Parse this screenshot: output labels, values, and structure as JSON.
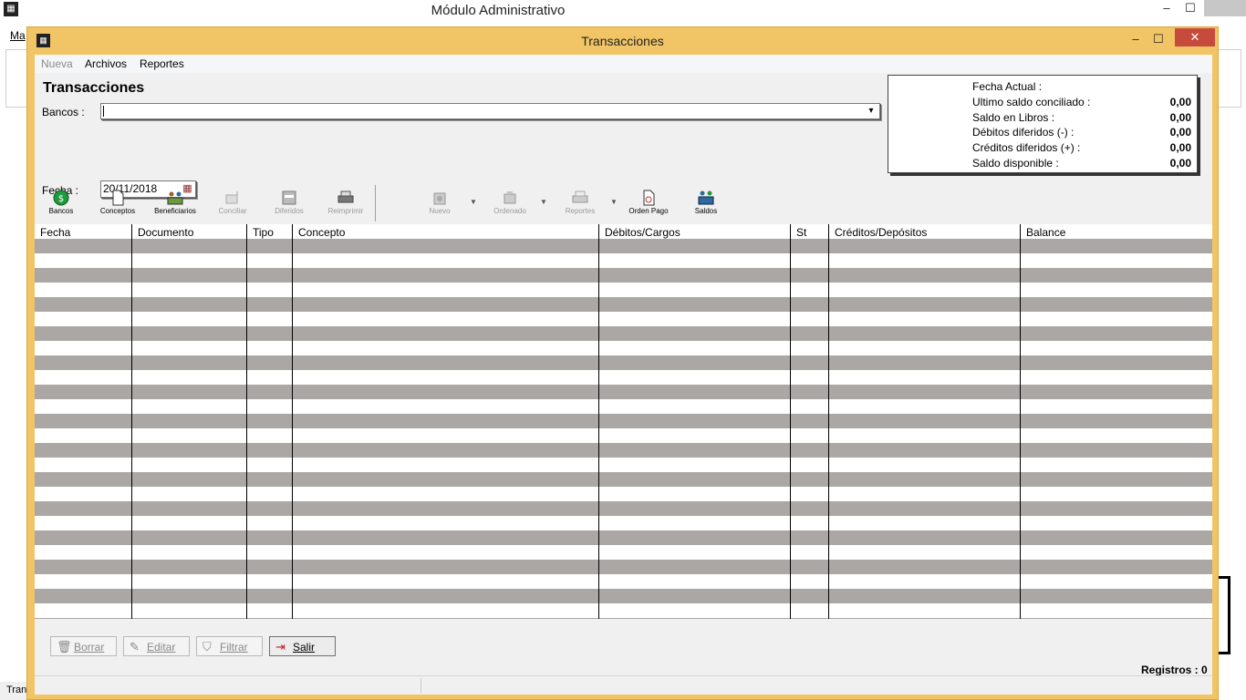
{
  "app": {
    "title": "Módulo Administrativo",
    "menu_fragment": "Ma",
    "status_fragment": "Tran",
    "minimize": "–",
    "maximize": "☐",
    "close": "✕"
  },
  "window": {
    "title": "Transacciones",
    "minimize": "–",
    "maximize": "☐",
    "close": "✕"
  },
  "menu": {
    "nueva": "Nueva",
    "archivos": "Archivos",
    "reportes": "Reportes"
  },
  "form": {
    "heading": "Transacciones",
    "bancos_label": "Bancos  :",
    "bancos_value": "",
    "fecha_label": "Fecha :",
    "fecha_value": "20/11/2018"
  },
  "summary": {
    "fecha_actual_label": "Fecha Actual :",
    "fecha_actual_value": "",
    "ultimo_saldo_label": "Ultimo saldo conciliado :",
    "ultimo_saldo_value": "0,00",
    "saldo_libros_label": "Saldo en Libros :",
    "saldo_libros_value": "0,00",
    "debitos_label": "Débitos diferidos (-) :",
    "debitos_value": "0,00",
    "creditos_label": "Créditos diferidos (+) :",
    "creditos_value": "0,00",
    "saldo_disp_label": "Saldo disponible :",
    "saldo_disp_value": "0,00"
  },
  "toolbar": {
    "bancos": "Bancos",
    "conceptos": "Conceptos",
    "beneficiarios": "Beneficiarios",
    "conciliar": "Conciliar",
    "diferidos": "Diferidos",
    "reimprimir": "Reimprimir",
    "nuevo": "Nuevo",
    "ordenado": "Ordenado",
    "reportes": "Reportes",
    "orden_pago": "Orden Pago",
    "saldos": "Saldos"
  },
  "grid": {
    "columns": [
      "Fecha",
      "Documento",
      "Tipo",
      "Concepto",
      "Débitos/Cargos",
      "St",
      "Créditos/Depósitos",
      "Balance"
    ]
  },
  "buttons": {
    "borrar": "Borrar",
    "editar": "Editar",
    "filtrar": "Filtrar",
    "salir": "Salir"
  },
  "footer": {
    "registros": "Registros : 0"
  },
  "colors": {
    "window_frame": "#f1c565",
    "close_button": "#c74b3c",
    "grid_stripe": "#aba7a4"
  }
}
